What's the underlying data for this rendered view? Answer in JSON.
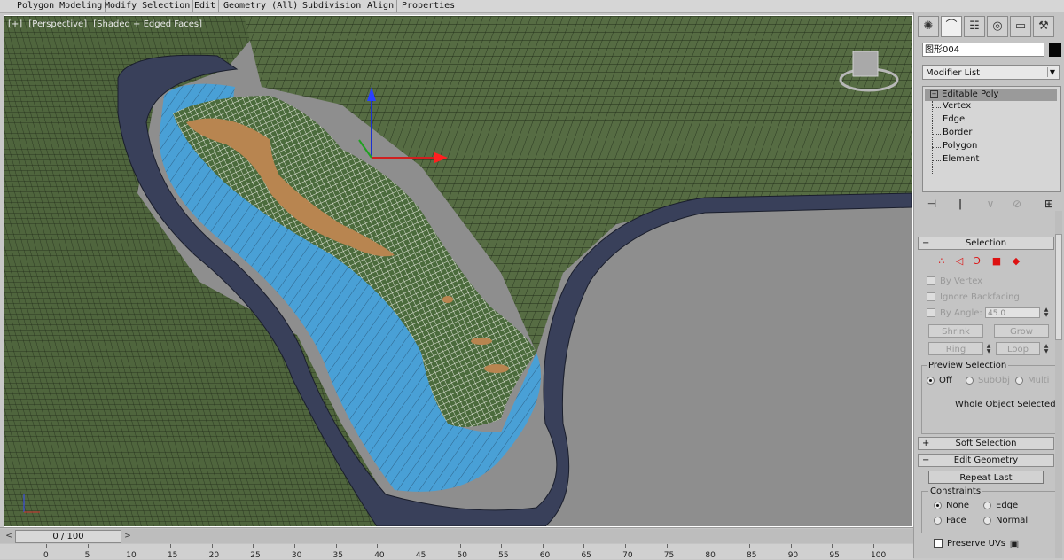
{
  "ribbon": {
    "tabs": [
      "Polygon Modeling",
      "Modify Selection",
      "Edit",
      "Geometry (All)",
      "Subdivision",
      "Align",
      "Properties"
    ]
  },
  "viewport": {
    "label_parts": [
      "[+]",
      "[Perspective]",
      "[Shaded + Edged Faces]"
    ],
    "colors": {
      "terrain": "#556b42",
      "water": "#4aa0d6",
      "sand": "#b88550",
      "road": "#39405a",
      "background": "#8e8e8e"
    }
  },
  "timeline": {
    "frame_display": "0 / 100",
    "current_frame": 0,
    "ticks": [
      "0",
      "5",
      "10",
      "15",
      "20",
      "25",
      "30",
      "35",
      "40",
      "45",
      "50",
      "55",
      "60",
      "65",
      "70",
      "75",
      "80",
      "85",
      "90",
      "95",
      "100"
    ]
  },
  "panel": {
    "tabs": [
      "create-icon",
      "modify-icon",
      "hierarchy-icon",
      "motion-icon",
      "display-icon",
      "utilities-icon"
    ],
    "object_name": "图形004",
    "object_color": "#050505",
    "modifier_list_label": "Modifier List",
    "stack": {
      "base": "Editable Poly",
      "subobjects": [
        "Vertex",
        "Edge",
        "Border",
        "Polygon",
        "Element"
      ]
    },
    "selection": {
      "title": "Selection",
      "by_vertex": "By Vertex",
      "ignore_backfacing": "Ignore Backfacing",
      "by_angle": "By Angle:",
      "angle_value": "45.0",
      "shrink": "Shrink",
      "grow": "Grow",
      "ring": "Ring",
      "loop": "Loop",
      "preview_label": "Preview Selection",
      "preview_options": [
        "Off",
        "SubObj",
        "Multi"
      ],
      "preview_selected": "Off",
      "status": "Whole Object Selected"
    },
    "soft_selection": {
      "title": "Soft Selection"
    },
    "edit_geometry": {
      "title": "Edit Geometry",
      "repeat_last": "Repeat Last",
      "constraints_label": "Constraints",
      "constraints": [
        "None",
        "Edge",
        "Face",
        "Normal"
      ],
      "constraint_selected": "None",
      "preserve_uvs": "Preserve UVs"
    }
  }
}
